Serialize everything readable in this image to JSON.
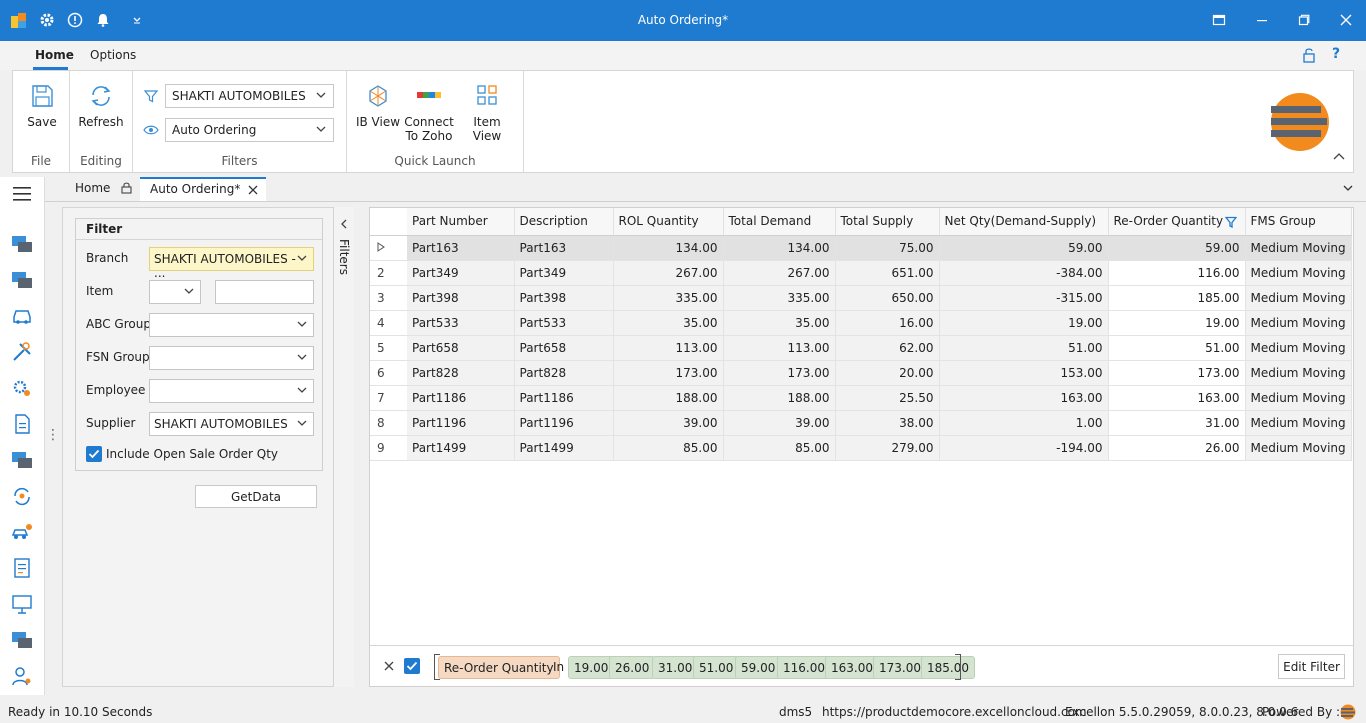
{
  "window": {
    "title": "Auto Ordering*"
  },
  "ribbon_tabs": [
    "Home",
    "Options"
  ],
  "ribbon": {
    "file": {
      "label": "File",
      "save": "Save"
    },
    "editing": {
      "label": "Editing",
      "refresh": "Refresh"
    },
    "filters": {
      "label": "Filters",
      "branch": "SHAKTI AUTOMOBILES",
      "view": "Auto Ordering"
    },
    "quick_launch": {
      "label": "Quick Launch",
      "ib_view": "IB View",
      "connect_line1": "Connect",
      "connect_line2": "To Zoho",
      "item_view": "Item View"
    }
  },
  "doc_tabs": {
    "home": "Home",
    "active": "Auto Ordering*"
  },
  "filter_panel": {
    "title": "Filter",
    "branch_label": "Branch",
    "branch_value": "SHAKTI AUTOMOBILES - ...",
    "item_label": "Item",
    "abc_label": "ABC Group",
    "fsn_label": "FSN Group",
    "employee_label": "Employee",
    "supplier_label": "Supplier",
    "supplier_value": "SHAKTI AUTOMOBILES",
    "include_label": "Include Open Sale Order Qty",
    "include_checked": true,
    "getdata": "GetData",
    "side_tab": "Filters"
  },
  "grid": {
    "columns": [
      "Part Number",
      "Description",
      "ROL Quantity",
      "Total Demand",
      "Total Supply",
      "Net Qty(Demand-Supply)",
      "Re-Order Quantity",
      "FMS Group"
    ],
    "rows": [
      [
        "",
        "Part163",
        "Part163",
        "134.00",
        "134.00",
        "75.00",
        "59.00",
        "59.00",
        "Medium Moving"
      ],
      [
        "2",
        "Part349",
        "Part349",
        "267.00",
        "267.00",
        "651.00",
        "-384.00",
        "116.00",
        "Medium Moving"
      ],
      [
        "3",
        "Part398",
        "Part398",
        "335.00",
        "335.00",
        "650.00",
        "-315.00",
        "185.00",
        "Medium Moving"
      ],
      [
        "4",
        "Part533",
        "Part533",
        "35.00",
        "35.00",
        "16.00",
        "19.00",
        "19.00",
        "Medium Moving"
      ],
      [
        "5",
        "Part658",
        "Part658",
        "113.00",
        "113.00",
        "62.00",
        "51.00",
        "51.00",
        "Medium Moving"
      ],
      [
        "6",
        "Part828",
        "Part828",
        "173.00",
        "173.00",
        "20.00",
        "153.00",
        "173.00",
        "Medium Moving"
      ],
      [
        "7",
        "Part1186",
        "Part1186",
        "188.00",
        "188.00",
        "25.50",
        "163.00",
        "163.00",
        "Medium Moving"
      ],
      [
        "8",
        "Part1196",
        "Part1196",
        "39.00",
        "39.00",
        "38.00",
        "1.00",
        "31.00",
        "Medium Moving"
      ],
      [
        "9",
        "Part1499",
        "Part1499",
        "85.00",
        "85.00",
        "279.00",
        "-194.00",
        "26.00",
        "Medium Moving"
      ]
    ]
  },
  "filter_bar": {
    "field": "Re-Order Quantity",
    "op": "In",
    "values": [
      "19.00",
      "26.00",
      "31.00",
      "51.00",
      "59.00",
      "116.00",
      "163.00",
      "173.00",
      "185.00"
    ],
    "edit": "Edit Filter"
  },
  "status": {
    "ready": "Ready in 10.10 Seconds",
    "db": "dms5",
    "url": "https://productdemocore.excelloncloud.com",
    "version": "Excellon 5.5.0.29059, 8.0.0.23, 8.0.0.6",
    "powered": "Powered By :"
  },
  "colors": {
    "titlebar": "#1f7bd0",
    "accent": "#1f7bd0",
    "chip": "#d4e4d1",
    "field_chip": "#f5d9c2",
    "branch_field": "#fdf6c8"
  }
}
